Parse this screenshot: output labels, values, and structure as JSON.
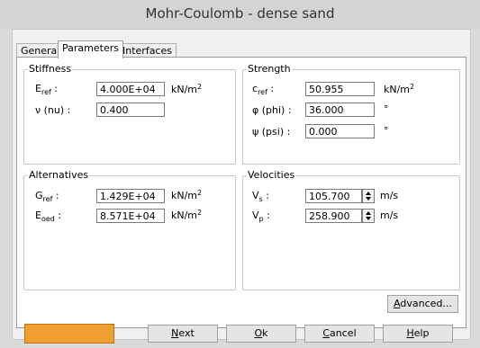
{
  "window": {
    "title": "Mohr-Coulomb - dense sand"
  },
  "tabs": [
    {
      "label": "General",
      "active": false
    },
    {
      "label": "Parameters",
      "active": true
    },
    {
      "label": "Interfaces",
      "active": false
    }
  ],
  "stiffness": {
    "title": "Stiffness",
    "eref_label": "E",
    "eref_sub": "ref",
    "eref_colon": " :",
    "eref_value": "4.000E+04",
    "eref_unit": "kN/m",
    "eref_unit_sup": "2",
    "nu_label": "ν (nu) :",
    "nu_value": "0.400"
  },
  "strength": {
    "title": "Strength",
    "cref_label": "c",
    "cref_sub": "ref",
    "cref_colon": " :",
    "cref_value": "50.955",
    "cref_unit": "kN/m",
    "cref_unit_sup": "2",
    "phi_label": "φ (phi) :",
    "phi_value": "36.000",
    "phi_unit": "°",
    "psi_label": "ψ (psi) :",
    "psi_value": "0.000",
    "psi_unit": "°"
  },
  "alternatives": {
    "title": "Alternatives",
    "gref_label": "G",
    "gref_sub": "ref",
    "gref_colon": " :",
    "gref_value": "1.429E+04",
    "gref_unit": "kN/m",
    "gref_unit_sup": "2",
    "eoed_label": "E",
    "eoed_sub": "oed",
    "eoed_colon": " :",
    "eoed_value": "8.571E+04",
    "eoed_unit": "kN/m",
    "eoed_unit_sup": "2"
  },
  "velocities": {
    "title": "Velocities",
    "vs_label": "V",
    "vs_sub": "s",
    "vs_colon": " :",
    "vs_value": "105.700",
    "vs_unit": "m/s",
    "vp_label": "V",
    "vp_sub": "p",
    "vp_colon": " :",
    "vp_value": "258.900",
    "vp_unit": "m/s"
  },
  "advanced_button": {
    "pre": "",
    "u": "A",
    "post": "dvanced..."
  },
  "bottom": {
    "color_swatch": "#f0a030",
    "next": {
      "u": "N",
      "post": "ext"
    },
    "ok": {
      "u": "O",
      "post": "k"
    },
    "cancel": {
      "u": "C",
      "post": "ancel"
    },
    "help": {
      "u": "H",
      "post": "elp"
    }
  }
}
